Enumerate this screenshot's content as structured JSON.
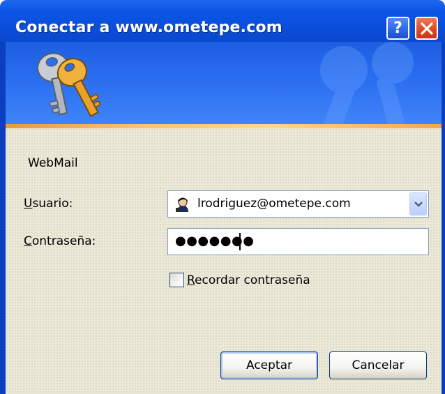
{
  "window": {
    "title": "Conectar a www.ometepe.com",
    "help_label": "?",
    "close_label": "✕"
  },
  "form": {
    "realm": "WebMail",
    "username_label": "Usuario:",
    "username_value": "lrodriguez@ometepe.com",
    "password_label": "Contraseña:",
    "password_masked": "●●●●●●●",
    "remember_label": "Recordar contraseña",
    "remember_checked": false
  },
  "buttons": {
    "ok_label": "Aceptar",
    "cancel_label": "Cancelar"
  },
  "icons": {
    "banner": "keys-icon",
    "user": "user-icon",
    "dropdown": "chevron-down-icon"
  },
  "colors": {
    "titlebar": "#0b55e6",
    "dialog_bg": "#ece9d8",
    "close_button": "#e04a22",
    "accent_stripe": "#f6c46b"
  }
}
